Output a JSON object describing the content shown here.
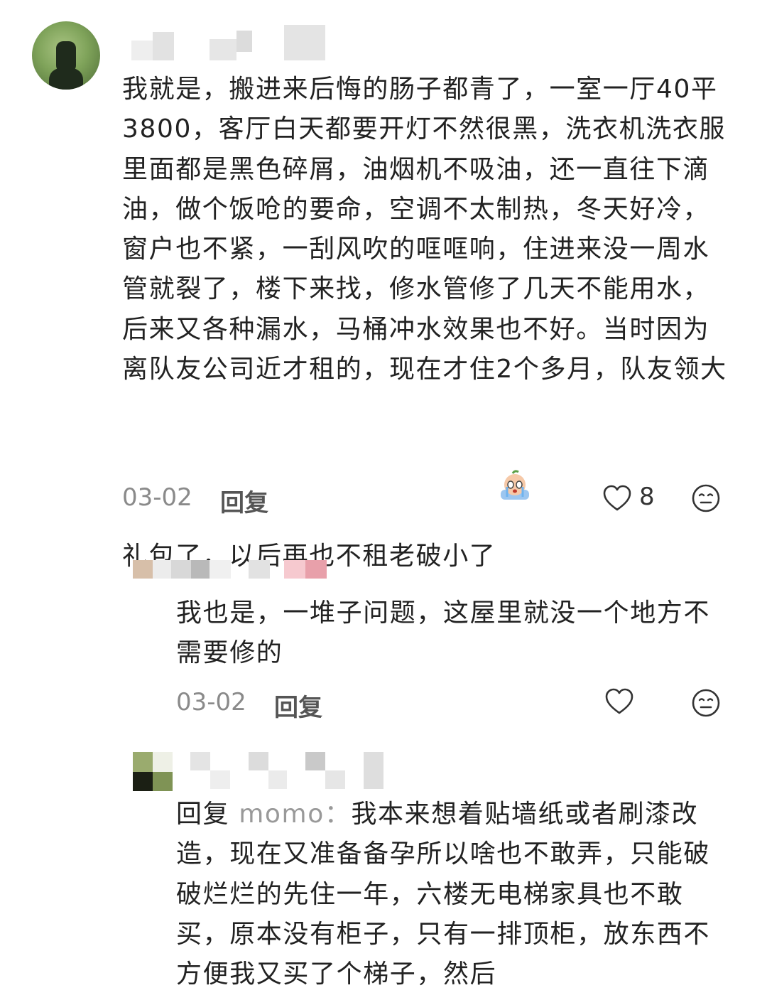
{
  "comments": [
    {
      "text": "我就是，搬进来后悔的肠子都青了，一室一厅40平3800，客厅白天都要开灯不然很黑，洗衣机洗衣服里面都是黑色碎屑，油烟机不吸油，还一直往下滴油，做个饭呛的要命，空调不太制热，冬天好冷，窗户也不紧，一刮风吹的哐哐响，住进来没一周水管就裂了，楼下来找，修水管修了几天不能用水，后来又各种漏水，马桶冲水效果也不好。当时因为离队友公司近才租的，现在才住2个多月，队友领大礼包了，以后再也不租老破小了",
      "emoji": "crying-face-emoji",
      "date": "03-02",
      "reply_label": "回复",
      "likes": "8",
      "like_icon": "heart-icon",
      "emoji_reaction_icon": "face-reaction-icon"
    },
    {
      "text": "我也是，一堆子问题，这屋里就没一个地方不需要修的",
      "date": "03-02",
      "reply_label": "回复",
      "like_icon": "heart-icon",
      "emoji_reaction_icon": "face-reaction-icon"
    },
    {
      "reply_prefix": "回复",
      "reply_to": "momo：",
      "text": "我本来想着贴墙纸或者刷漆改造，现在又准备备孕所以啥也不敢弄，只能破破烂烂的先住一年，六楼无电梯家具也不敢买，原本没有柜子，只有一排顶柜，放东西不方便我又买了个梯子，然后"
    }
  ]
}
